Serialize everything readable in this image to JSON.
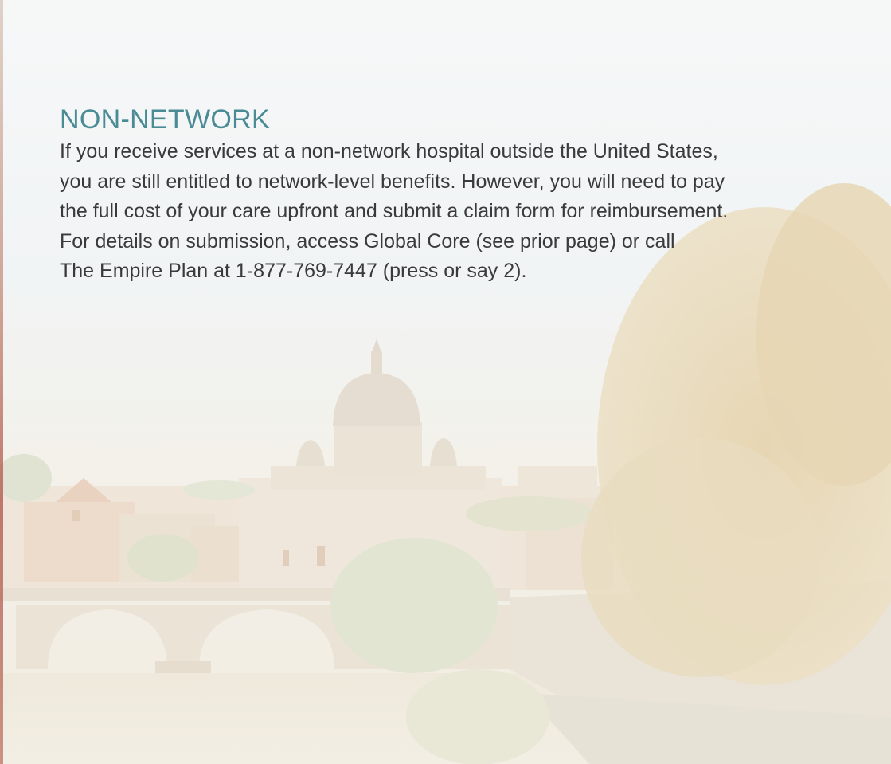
{
  "section": {
    "heading": "NON-NETWORK",
    "body_lines": [
      "If you receive services at a non-network hospital outside the United States,",
      "you are still entitled to network-level benefits. However, you will need to pay",
      "the full cost of your care upfront and submit a claim form for reimbursement.",
      "For details on submission, access Global Core (see prior page) or call",
      "The Empire Plan at 1-877-769-7447 (press or say 2)."
    ]
  },
  "colors": {
    "heading": "#4a8b96",
    "body_text": "#3a3a3a"
  }
}
